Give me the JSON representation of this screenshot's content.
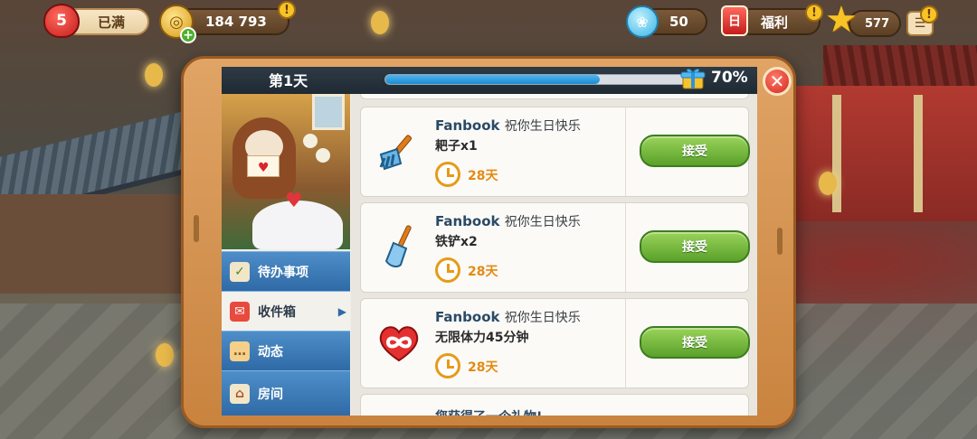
{
  "hud": {
    "lives": {
      "count": "5",
      "status": "已满"
    },
    "coins": {
      "amount": "184 793",
      "alert": "!"
    },
    "gems": {
      "amount": "50"
    },
    "welfare": {
      "label": "福利",
      "alert": "!"
    },
    "stars": {
      "amount": "577",
      "alert": "!"
    }
  },
  "dialog": {
    "day_label": "第1天",
    "progress_percent": 70,
    "progress_label": "70%",
    "close_symbol": "✕"
  },
  "sidebar": {
    "items": [
      {
        "label": "待办事项",
        "icon": "clipboard-icon"
      },
      {
        "label": "收件箱",
        "icon": "envelope-icon",
        "arrow": "▶"
      },
      {
        "label": "动态",
        "icon": "chat-icon"
      },
      {
        "label": "房间",
        "icon": "house-icon"
      }
    ]
  },
  "inbox": {
    "messages": [
      {
        "sender": "Fanbook",
        "greeting": "祝你生日快乐",
        "item": "耙子x1",
        "days": "28天",
        "button": "接受",
        "icon": "rake-icon"
      },
      {
        "sender": "Fanbook",
        "greeting": "祝你生日快乐",
        "item": "铁铲x2",
        "days": "28天",
        "button": "接受",
        "icon": "shovel-icon"
      },
      {
        "sender": "Fanbook",
        "greeting": "祝你生日快乐",
        "item": "无限体力45分钟",
        "days": "28天",
        "button": "接受",
        "icon": "infinite-heart-icon"
      }
    ],
    "partial_text": "您获得了一个礼物!"
  },
  "colors": {
    "accent_blue": "#2f6aa6",
    "accept_green": "#5aa12a",
    "days_orange": "#e48a12",
    "close_red": "#d3291e"
  }
}
